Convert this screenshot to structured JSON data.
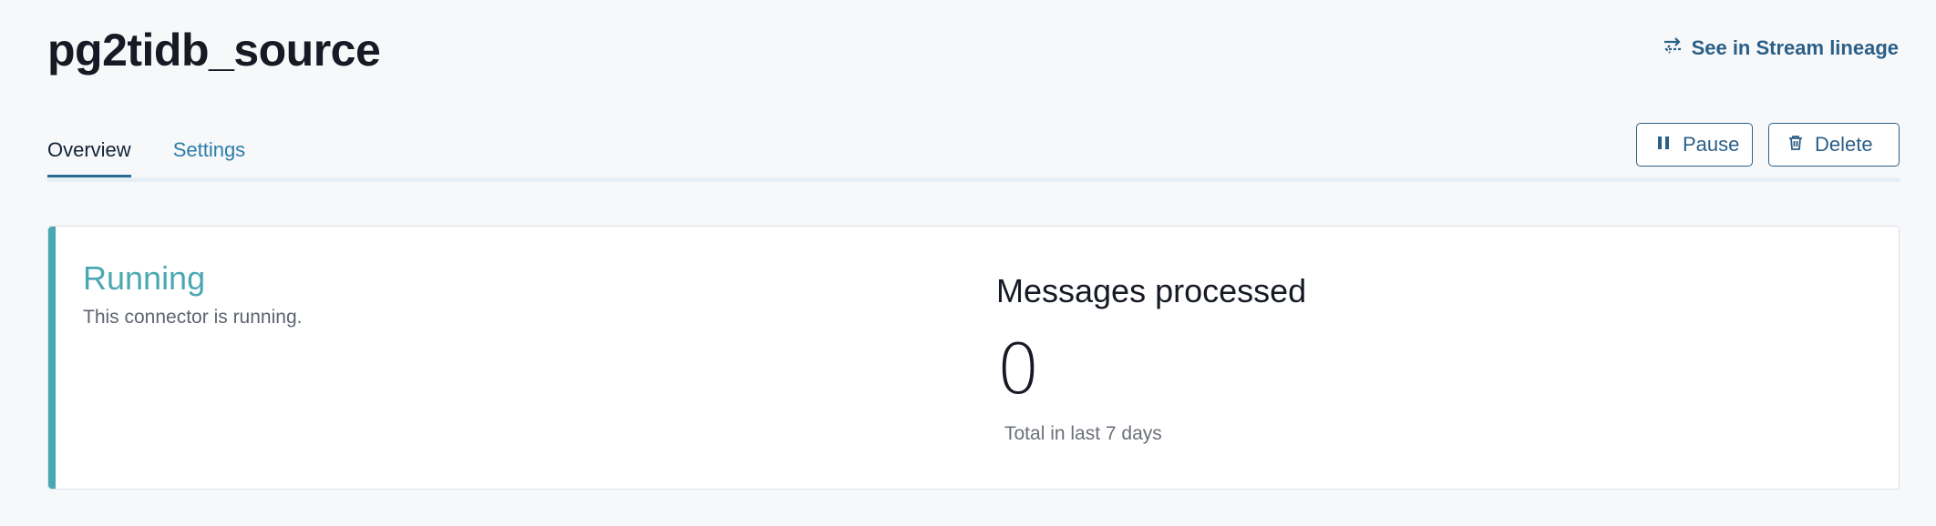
{
  "header": {
    "title": "pg2tidb_source",
    "lineage_link": {
      "label": "See in Stream lineage",
      "icon": "lineage-icon"
    }
  },
  "tabs": [
    {
      "label": "Overview",
      "active": true
    },
    {
      "label": "Settings",
      "active": false
    }
  ],
  "actions": {
    "pause": {
      "label": "Pause",
      "icon": "pause-icon"
    },
    "delete": {
      "label": "Delete",
      "icon": "trash-icon"
    }
  },
  "status": {
    "title": "Running",
    "description": "This connector is running.",
    "accent_color": "#4aa8b3"
  },
  "metrics": {
    "title": "Messages processed",
    "value": "0",
    "caption": "Total in last 7 days"
  },
  "colors": {
    "link": "#2a5f88",
    "tab_inactive": "#2c7ea9"
  }
}
